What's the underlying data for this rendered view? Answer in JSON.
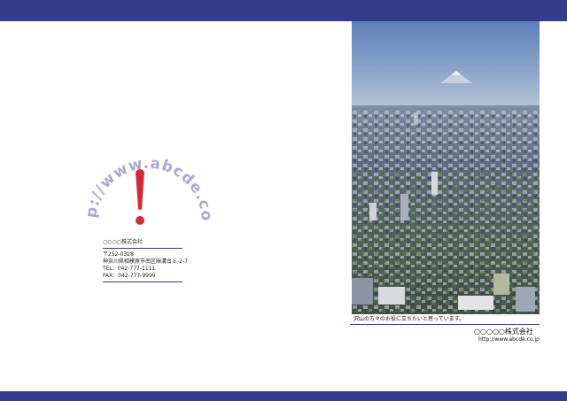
{
  "logo": {
    "arc_text": "http://www.abcde.co.jp",
    "mark": "!"
  },
  "info": {
    "company": "○○○○株式会社",
    "postal": "〒252-0328",
    "address": "神奈川県相模原市南区麻溝台８-2-7",
    "tel": "TEL：042-777-1111",
    "fax": "FAX：042-777-9999"
  },
  "photo": {
    "caption": "沢山の方々のお役に立ちたいと思っています。"
  },
  "footer": {
    "company": "○○○○○株式会社",
    "url": "http://www.abcde.co.jp"
  },
  "colors": {
    "band": "#333d8c",
    "logo_text": "#a9a9d6",
    "mark": "#d22a35"
  }
}
